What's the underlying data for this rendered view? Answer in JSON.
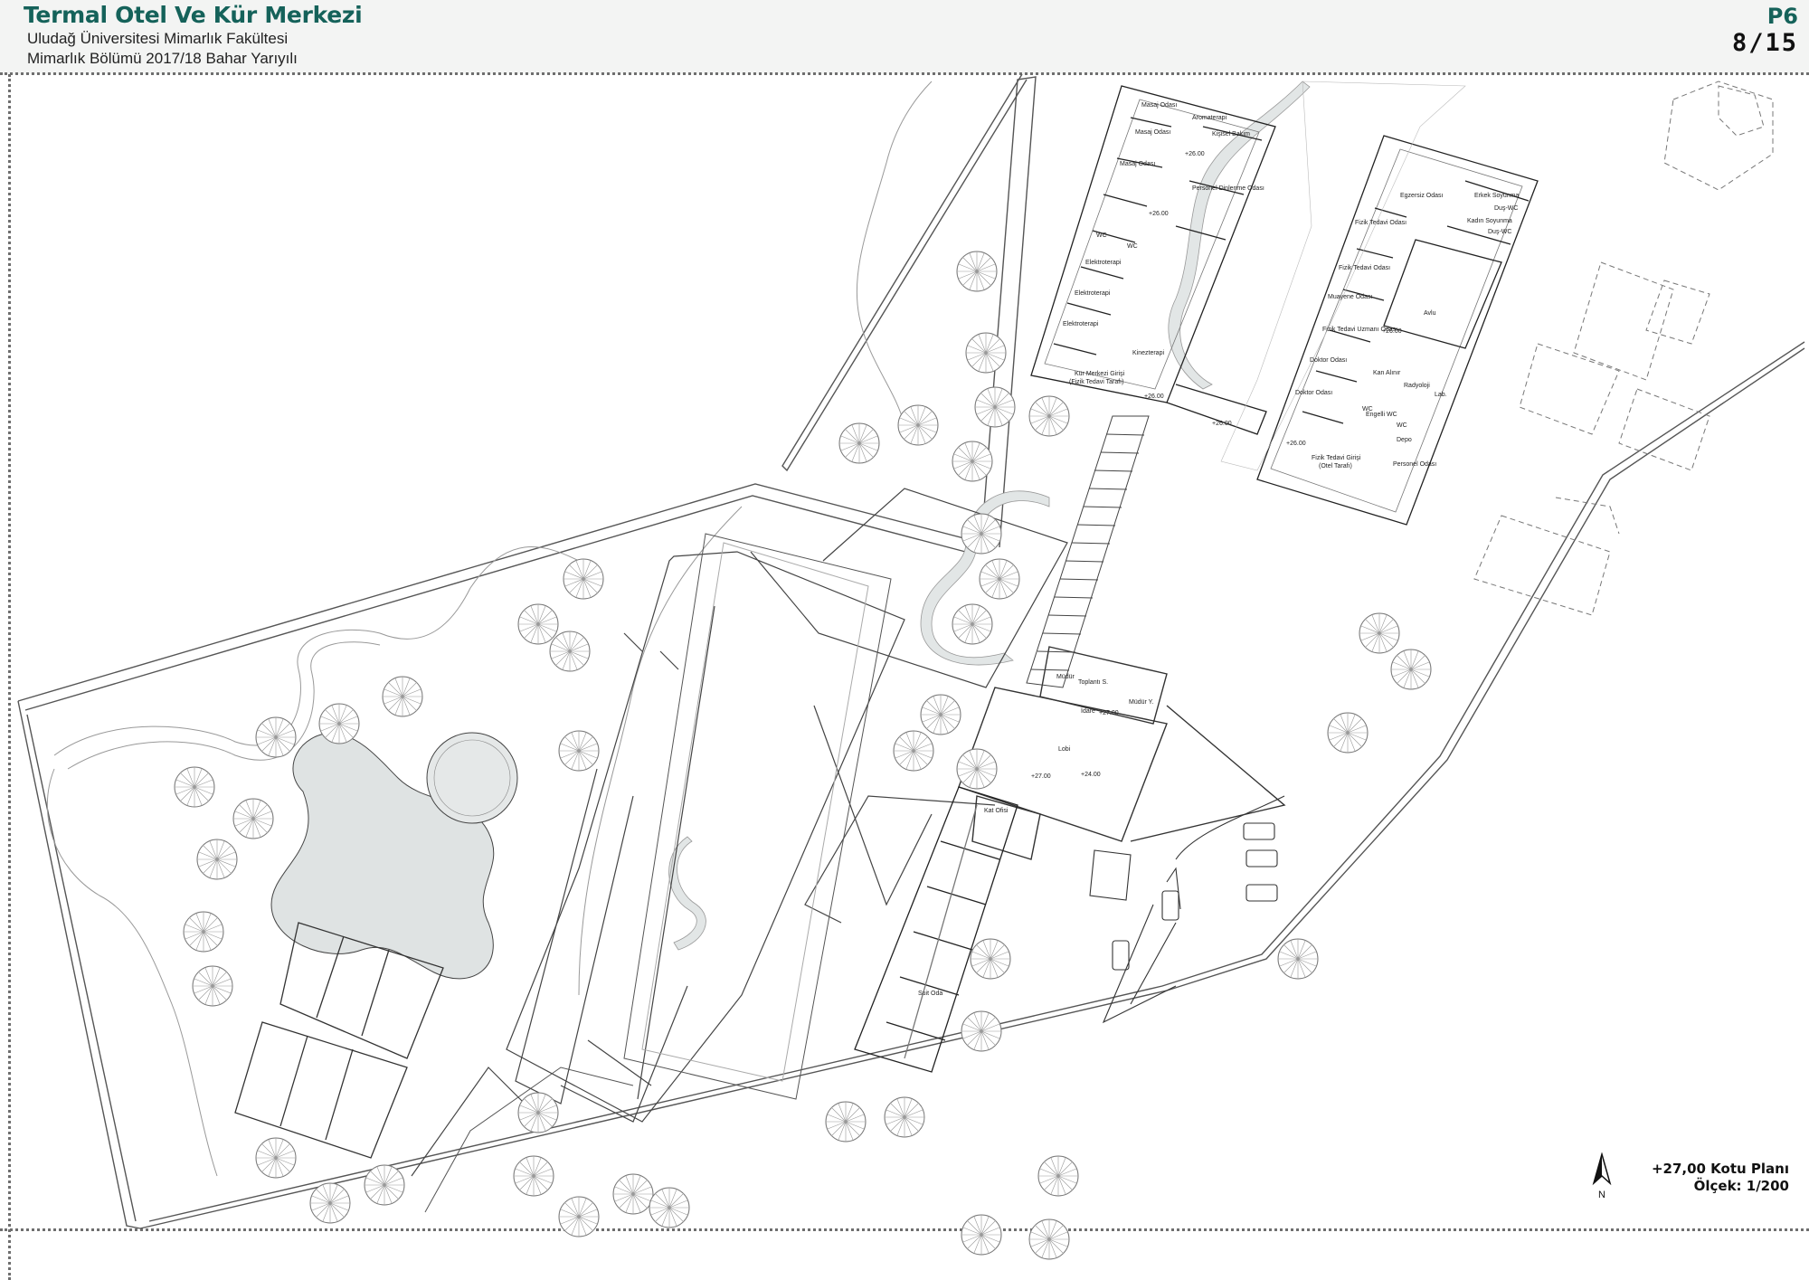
{
  "header": {
    "title": "Termal Otel Ve Kür Merkezi",
    "subtitle1": "Uludağ Üniversitesi Mimarlık Fakültesi",
    "subtitle2": "Mimarlık Bölümü 2017/18 Bahar Yarıyılı",
    "sheet_code": "P6",
    "sheet_number": "8/15"
  },
  "legend": {
    "plan_name": "+27,00 Kotu Planı",
    "scale": "Ölçek: 1/200",
    "north_label": "N"
  },
  "rooms": {
    "r01": "Masaj Odası",
    "r02": "Aromaterapi",
    "r03": "Masaj Odası",
    "r04": "Kişisel Bakım",
    "r05": "Masaj Odası",
    "r06": "Personel Dinlenme Odası",
    "r07": "WC",
    "r08": "WC",
    "r09": "Elektroterapi",
    "r10": "Elektroterapi",
    "r11": "Elektroterapi",
    "r12": "Kinezterapi",
    "r13": "Kür Merkezi Girişi",
    "r14": "(Fizik Tedavi Tarafı)",
    "r15": "Egzersiz Odası",
    "r16": "Erkek Soyunma",
    "r17": "Duş-WC",
    "r18": "Kadın Soyunma",
    "r19": "Duş-WC",
    "r20": "Fizik Tedavi Odası",
    "r21": "Fizik Tedavi Odası",
    "r22": "Avlu",
    "r23": "Muayene Odası",
    "r24": "Fizik Tedavi Uzmanı Odası",
    "r25": "Doktor Odası",
    "r26": "Kan Alınır",
    "r27": "Radyoloji",
    "r28": "Doktor Odası",
    "r29": "Lab.",
    "r30": "Engelli WC",
    "r31": "WC",
    "r32": "WC",
    "r33": "Depo",
    "r34": "Fizik Tedavi Girişi",
    "r35": "(Otel Tarafı)",
    "r36": "Personel Odası",
    "r37": "Müdür",
    "r38": "Toplantı S.",
    "r39": "Müdür Y.",
    "r40": "İdare",
    "r41": "Lobi",
    "r42": "Kat Ofisi",
    "r43": "Suit Oda"
  },
  "levels": {
    "l1": "+26.00",
    "l2": "+26.00",
    "l3": "+26.00",
    "l4": "+26.00",
    "l5": "+26.00",
    "l6": "+26.00",
    "l7": "+27.00",
    "l8": "+27.00",
    "l9": "+24.00"
  }
}
